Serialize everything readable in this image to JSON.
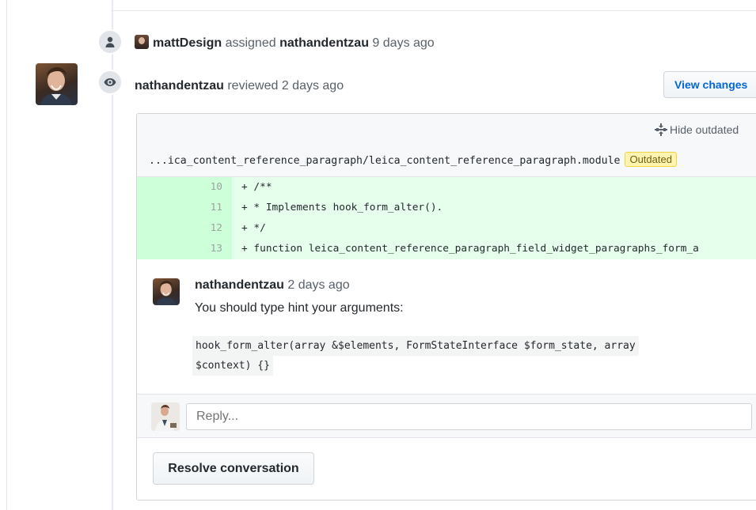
{
  "events": [
    {
      "icon": "person-icon",
      "actor": "mattDesign",
      "action": "assigned",
      "target": "nathandentzau",
      "time": "9 days ago"
    },
    {
      "icon": "eye-icon",
      "actor": "nathandentzau",
      "action": "reviewed 2 days ago",
      "button": "View changes"
    }
  ],
  "review": {
    "hide_outdated": "Hide outdated",
    "file_path": "...ica_content_reference_paragraph/leica_content_reference_paragraph.module",
    "outdated_label": "Outdated",
    "diff_lines": [
      {
        "num": "10",
        "code": "+ /**"
      },
      {
        "num": "11",
        "code": "+  * Implements hook_form_alter()."
      },
      {
        "num": "12",
        "code": "+  */"
      },
      {
        "num": "13",
        "code": "+ function leica_content_reference_paragraph_field_widget_paragraphs_form_a"
      }
    ],
    "comment": {
      "author": "nathandentzau",
      "time": "2 days ago",
      "body": "You should type hint your arguments:",
      "code_line_1": "hook_form_alter(array &$elements, FormStateInterface $form_state, array",
      "code_line_2": "$context) {}"
    },
    "reply_placeholder": "Reply...",
    "resolve_label": "Resolve conversation"
  }
}
